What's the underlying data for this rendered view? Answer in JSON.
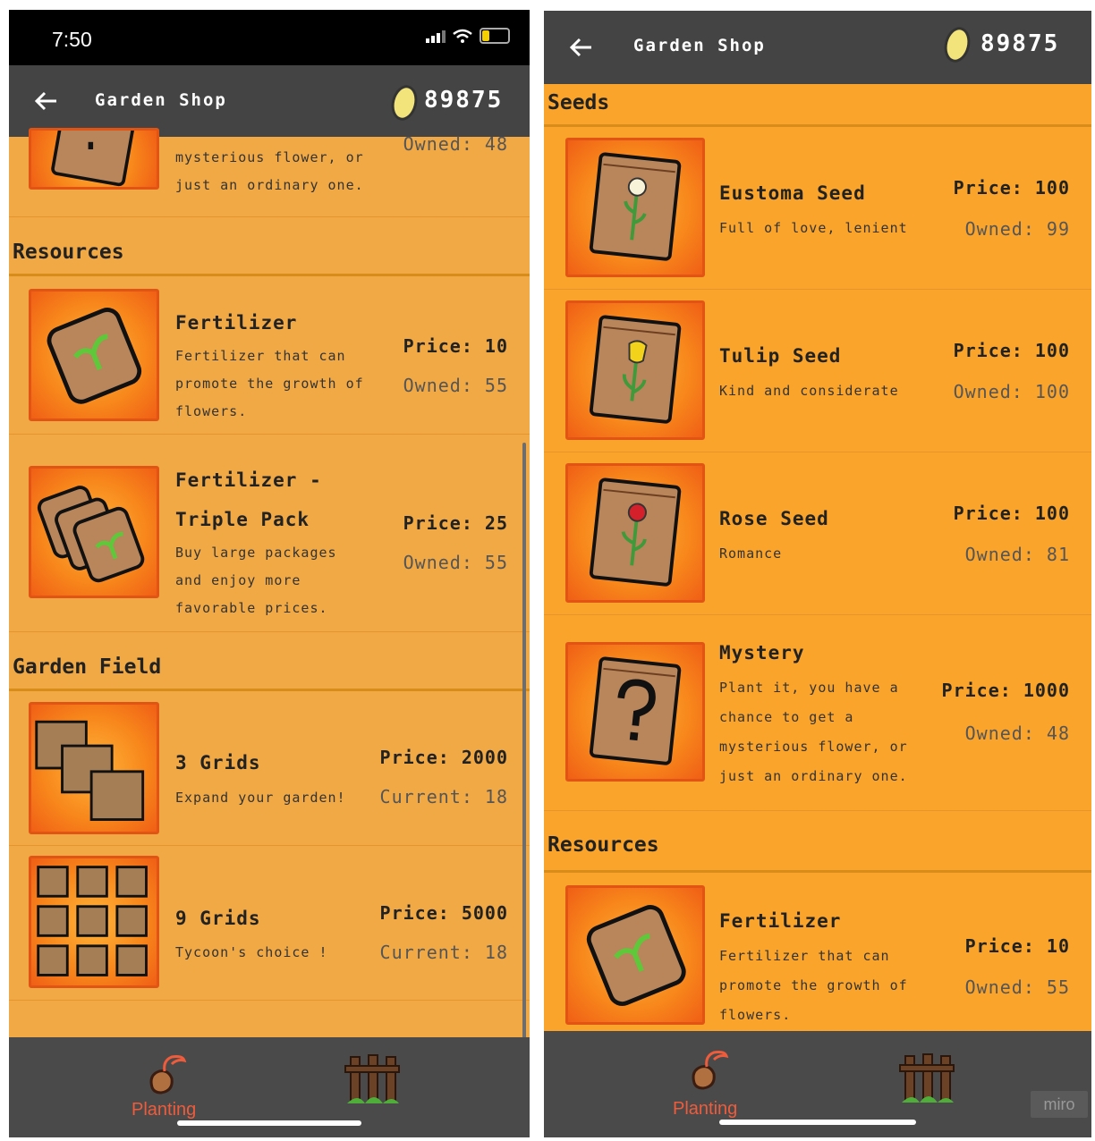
{
  "status": {
    "time": "7:50"
  },
  "app": {
    "title": "Garden Shop",
    "coins": "89875"
  },
  "sections": {
    "seeds": "Seeds",
    "resources": "Resources",
    "garden_field": "Garden Field"
  },
  "items": {
    "eustoma": {
      "name": "Eustoma Seed",
      "desc": "Full of love, lenient",
      "price": "Price: 100",
      "owned": "Owned: 99"
    },
    "tulip": {
      "name": "Tulip Seed",
      "desc": "Kind and considerate",
      "price": "Price: 100",
      "owned": "Owned: 100"
    },
    "rose": {
      "name": "Rose Seed",
      "desc": "Romance",
      "price": "Price: 100",
      "owned": "Owned: 81"
    },
    "mystery": {
      "name": "Mystery",
      "desc_lines": [
        "Plant it, you have a",
        "chance to get a",
        "mysterious flower, or",
        "just an ordinary one."
      ],
      "price": "Price: 1000",
      "owned": "Owned: 48"
    },
    "fertilizer": {
      "name": "Fertilizer",
      "desc_lines": [
        "Fertilizer that can",
        "promote the growth of",
        "flowers."
      ],
      "price": "Price: 10",
      "owned": "Owned: 55"
    },
    "fertilizer_triple": {
      "name_lines": [
        "Fertilizer -",
        "Triple Pack"
      ],
      "desc_lines": [
        "Buy large packages",
        "and enjoy more",
        "favorable prices."
      ],
      "price": "Price: 25",
      "owned": "Owned: 55"
    },
    "grid3": {
      "name": "3 Grids",
      "desc": "Expand your garden!",
      "price": "Price: 2000",
      "current": "Current: 18"
    },
    "grid9": {
      "name": "9 Grids",
      "desc": "Tycoon's choice !",
      "price": "Price: 5000",
      "current": "Current: 18"
    }
  },
  "left_partial_mystery": {
    "desc_lines": [
      "mysterious flower, or",
      "just an ordinary one."
    ],
    "owned": "Owned: 48"
  },
  "nav": {
    "planting": "Planting"
  },
  "icons": [
    "back-arrow-icon",
    "coin-icon",
    "seed-packet-icon",
    "fertilizer-bag-icon",
    "soil-grid-icon",
    "planting-icon",
    "fence-icon"
  ],
  "watermark": "miro",
  "colors": {
    "accent": "#faa42c",
    "appbar": "#444444",
    "nav_active": "#ee5c3c"
  }
}
